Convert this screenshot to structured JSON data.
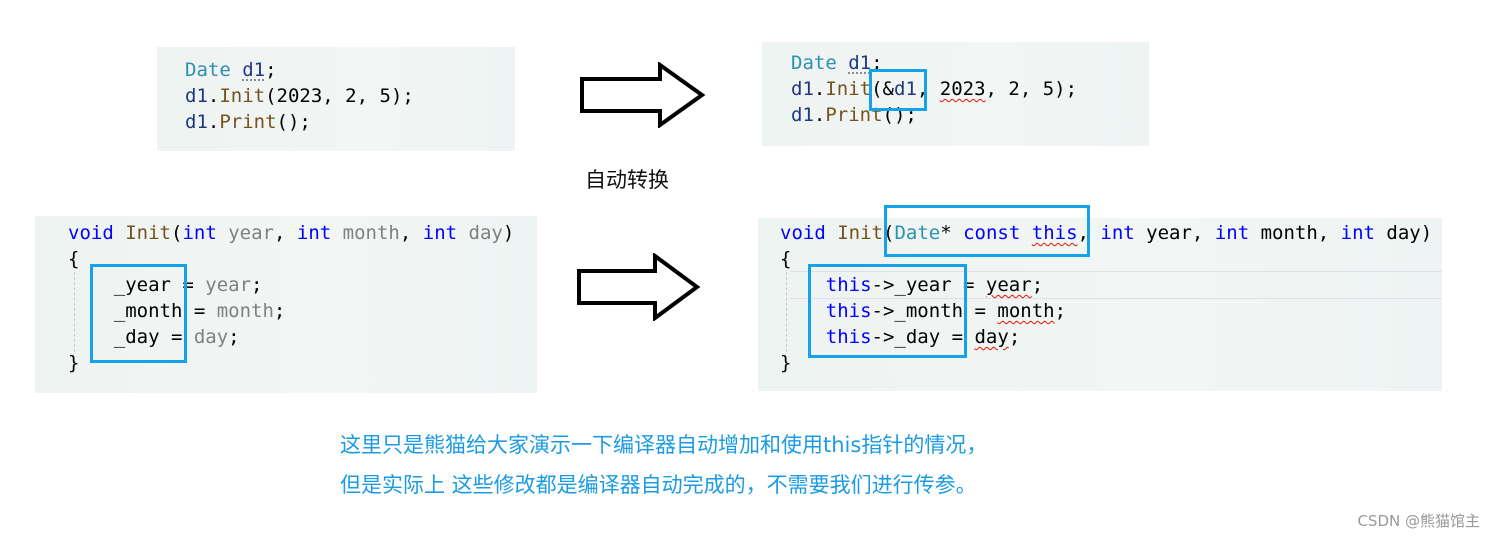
{
  "panels": [
    {
      "lines": [
        [
          {
            "t": "Date",
            "c": "ty"
          },
          {
            "t": " "
          },
          {
            "t": "d1",
            "c": "var dot"
          },
          {
            "t": ";"
          }
        ],
        [
          {
            "t": "d1",
            "c": "var"
          },
          {
            "t": "."
          },
          {
            "t": "Init",
            "c": "fn"
          },
          {
            "t": "(2023, 2, 5);"
          }
        ],
        [
          {
            "t": "d1",
            "c": "var"
          },
          {
            "t": "."
          },
          {
            "t": "Print",
            "c": "fn"
          },
          {
            "t": "();"
          }
        ]
      ]
    },
    {
      "lines": [
        [
          {
            "t": "Date",
            "c": "ty"
          },
          {
            "t": " "
          },
          {
            "t": "d1",
            "c": "var dot"
          },
          {
            "t": ";"
          }
        ],
        [
          {
            "t": "d1",
            "c": "var"
          },
          {
            "t": "."
          },
          {
            "t": "Init",
            "c": "fn"
          },
          {
            "t": "(&"
          },
          {
            "t": "d1",
            "c": "var"
          },
          {
            "t": ", "
          },
          {
            "t": "2023",
            "c": "sq"
          },
          {
            "t": ", 2, 5);"
          }
        ],
        [
          {
            "t": "d1",
            "c": "var"
          },
          {
            "t": "."
          },
          {
            "t": "Print",
            "c": "fn"
          },
          {
            "t": "();"
          }
        ]
      ]
    },
    {
      "lines": [
        [
          {
            "t": "void",
            "c": "kw"
          },
          {
            "t": " "
          },
          {
            "t": "Init",
            "c": "fn"
          },
          {
            "t": "("
          },
          {
            "t": "int",
            "c": "kw"
          },
          {
            "t": " "
          },
          {
            "t": "year",
            "c": "prm"
          },
          {
            "t": ", "
          },
          {
            "t": "int",
            "c": "kw"
          },
          {
            "t": " "
          },
          {
            "t": "month",
            "c": "prm"
          },
          {
            "t": ", "
          },
          {
            "t": "int",
            "c": "kw"
          },
          {
            "t": " "
          },
          {
            "t": "day",
            "c": "prm"
          },
          {
            "t": ")"
          }
        ],
        [
          {
            "t": "{"
          }
        ],
        [
          {
            "t": "    _year = "
          },
          {
            "t": "year",
            "c": "prm"
          },
          {
            "t": ";"
          }
        ],
        [
          {
            "t": "    _month = "
          },
          {
            "t": "month",
            "c": "prm"
          },
          {
            "t": ";"
          }
        ],
        [
          {
            "t": "    _day = "
          },
          {
            "t": "day",
            "c": "prm"
          },
          {
            "t": ";"
          }
        ],
        [
          {
            "t": "}"
          }
        ]
      ]
    },
    {
      "lines": [
        [
          {
            "t": "void",
            "c": "kw"
          },
          {
            "t": " "
          },
          {
            "t": "Init",
            "c": "fn"
          },
          {
            "t": "("
          },
          {
            "t": "Date",
            "c": "ty"
          },
          {
            "t": "* "
          },
          {
            "t": "const",
            "c": "kw"
          },
          {
            "t": " "
          },
          {
            "t": "this",
            "c": "kw sq"
          },
          {
            "t": ", "
          },
          {
            "t": "int",
            "c": "kw"
          },
          {
            "t": " year, "
          },
          {
            "t": "int",
            "c": "kw"
          },
          {
            "t": " month, "
          },
          {
            "t": "int",
            "c": "kw"
          },
          {
            "t": " day)"
          }
        ],
        [
          {
            "t": "{"
          }
        ],
        [
          {
            "t": "    "
          },
          {
            "t": "this",
            "c": "kw"
          },
          {
            "t": "->_year = "
          },
          {
            "t": "year",
            "c": "sq"
          },
          {
            "t": ";"
          }
        ],
        [
          {
            "t": "    "
          },
          {
            "t": "this",
            "c": "kw"
          },
          {
            "t": "->_month = "
          },
          {
            "t": "month",
            "c": "sq"
          },
          {
            "t": ";"
          }
        ],
        [
          {
            "t": "    "
          },
          {
            "t": "this",
            "c": "kw"
          },
          {
            "t": "->_day = "
          },
          {
            "t": "day",
            "c": "sq"
          },
          {
            "t": ";"
          }
        ],
        [
          {
            "t": "}"
          }
        ]
      ]
    }
  ],
  "arrow_label": "自动转换",
  "notes": [
    "这里只是熊猫给大家演示一下编译器自动增加和使用this指针的情况，",
    "但是实际上 这些修改都是编译器自动完成的，不需要我们进行传参。"
  ],
  "watermark": "CSDN @熊猫馆主",
  "colors": {
    "highlight": "#13a3e6",
    "note": "#1a9be3",
    "keyword": "#0000ff",
    "type": "#2b91af",
    "function": "#74531f"
  }
}
